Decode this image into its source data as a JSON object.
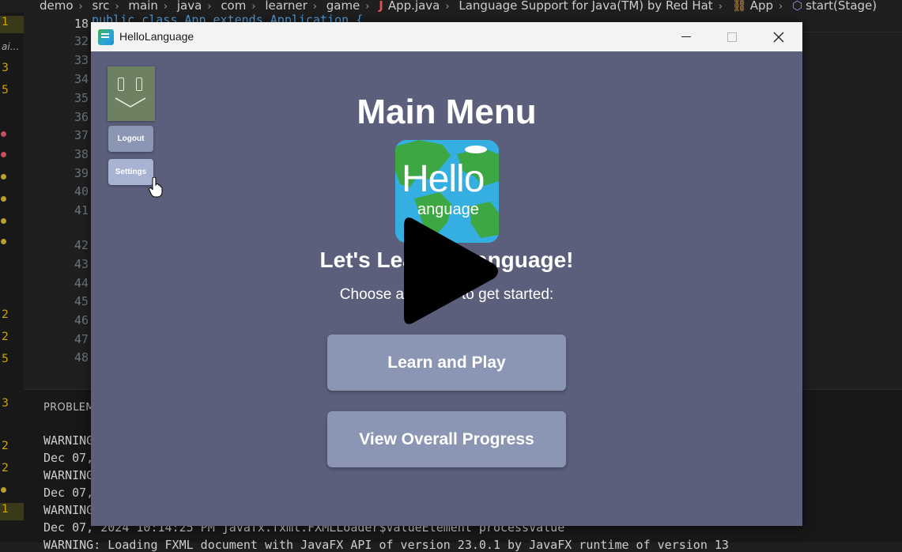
{
  "ide": {
    "breadcrumb": [
      "demo",
      "src",
      "main",
      "java",
      "com",
      "learner",
      "game",
      "App.java",
      "Language Support for Java(TM) by Red Hat",
      "App",
      "start(Stage)"
    ],
    "code_peek": "public class App extends Application {",
    "line_numbers": [
      "18",
      "32",
      "33",
      "34",
      "35",
      "36",
      "37",
      "38",
      "39",
      "40",
      "41",
      "42",
      "43",
      "44",
      "45",
      "46",
      "47",
      "48"
    ],
    "activity_counts": [
      "1",
      "3",
      "5",
      "2",
      "2",
      "5",
      "3",
      "2",
      "2",
      "1"
    ],
    "activity_label": "ai...",
    "panel_title": "PROBLEMS",
    "terminal_lines": [
      "WARNING",
      "Dec 07,",
      "WARNING",
      "Dec 07,",
      "WARNING",
      "Dec 07, 2024 10:14:25 PM javafx.fxml.FXMLLoader$ValueElement processValue",
      "WARNING: Loading FXML document with JavaFX API of version 23.0.1 by JavaFX runtime of version 13"
    ]
  },
  "window": {
    "title": "HelloLanguage"
  },
  "app": {
    "logout_label": "Logout",
    "settings_label": "Settings",
    "main_title": "Main Menu",
    "logo_line1": "Hello",
    "logo_line2": "anguage",
    "tagline": "Let's Learn a Language!",
    "subtitle": "Choose an option to get started:",
    "learn_button": "Learn and Play",
    "progress_button": "View Overall Progress"
  },
  "colors": {
    "app_background": "#5b5f7c",
    "button": "#8a96b4",
    "button_hover": "#a8b3d3",
    "avatar": "#6d8062"
  }
}
